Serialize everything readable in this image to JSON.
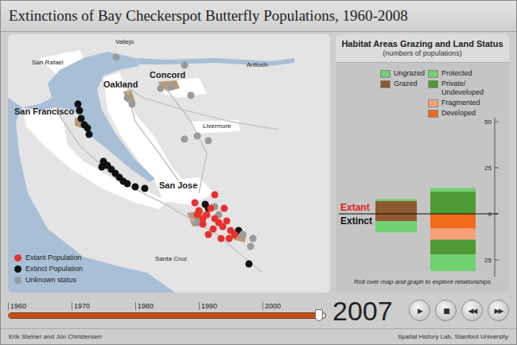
{
  "title": "Extinctions of Bay Checkerspot Butterfly Populations, 1960-2008",
  "map": {
    "cities": [
      {
        "name": "Vallejo",
        "major": false
      },
      {
        "name": "San Rafael",
        "major": false
      },
      {
        "name": "Antioch",
        "major": false
      },
      {
        "name": "Oakland",
        "major": true
      },
      {
        "name": "Concord",
        "major": true
      },
      {
        "name": "San Francisco",
        "major": true
      },
      {
        "name": "Livermore",
        "major": false
      },
      {
        "name": "San Jose",
        "major": true
      },
      {
        "name": "Santa Cruz",
        "major": false
      }
    ],
    "populations": [
      {
        "status": "extinct",
        "color": "#111111"
      },
      {
        "status": "extinct",
        "color": "#111111"
      },
      {
        "status": "extinct",
        "color": "#111111"
      },
      {
        "status": "extinct",
        "color": "#111111"
      },
      {
        "status": "extinct",
        "color": "#111111"
      },
      {
        "status": "extinct",
        "color": "#111111"
      },
      {
        "status": "extinct",
        "color": "#111111"
      },
      {
        "status": "extinct",
        "color": "#111111"
      },
      {
        "status": "extinct",
        "color": "#111111"
      },
      {
        "status": "extinct",
        "color": "#111111"
      },
      {
        "status": "extinct",
        "color": "#111111"
      },
      {
        "status": "extinct",
        "color": "#111111"
      },
      {
        "status": "extinct",
        "color": "#111111"
      },
      {
        "status": "extinct",
        "color": "#111111"
      },
      {
        "status": "extinct",
        "color": "#111111"
      },
      {
        "status": "extinct",
        "color": "#111111"
      },
      {
        "status": "extinct",
        "color": "#111111"
      },
      {
        "status": "extinct",
        "color": "#111111"
      },
      {
        "status": "extinct",
        "color": "#111111"
      },
      {
        "status": "extinct",
        "color": "#111111"
      },
      {
        "status": "unknown",
        "color": "#9a9a9a"
      },
      {
        "status": "unknown",
        "color": "#9a9a9a"
      },
      {
        "status": "unknown",
        "color": "#9a9a9a"
      },
      {
        "status": "unknown",
        "color": "#9a9a9a"
      },
      {
        "status": "unknown",
        "color": "#9a9a9a"
      },
      {
        "status": "unknown",
        "color": "#9a9a9a"
      },
      {
        "status": "unknown",
        "color": "#9a9a9a"
      },
      {
        "status": "unknown",
        "color": "#9a9a9a"
      },
      {
        "status": "unknown",
        "color": "#9a9a9a"
      },
      {
        "status": "unknown",
        "color": "#9a9a9a"
      },
      {
        "status": "unknown",
        "color": "#9a9a9a"
      },
      {
        "status": "unknown",
        "color": "#9a9a9a"
      },
      {
        "status": "unknown",
        "color": "#9a9a9a"
      },
      {
        "status": "unknown",
        "color": "#9a9a9a"
      },
      {
        "status": "unknown",
        "color": "#9a9a9a"
      },
      {
        "status": "unknown",
        "color": "#9a9a9a"
      },
      {
        "status": "extant",
        "color": "#e8312f"
      },
      {
        "status": "extant",
        "color": "#e8312f"
      },
      {
        "status": "extant",
        "color": "#e8312f"
      },
      {
        "status": "extant",
        "color": "#e8312f"
      },
      {
        "status": "extant",
        "color": "#e8312f"
      },
      {
        "status": "extant",
        "color": "#e8312f"
      },
      {
        "status": "extant",
        "color": "#e8312f"
      },
      {
        "status": "extant",
        "color": "#e8312f"
      },
      {
        "status": "extant",
        "color": "#e8312f"
      },
      {
        "status": "extant",
        "color": "#e8312f"
      },
      {
        "status": "extant",
        "color": "#e8312f"
      },
      {
        "status": "extant",
        "color": "#e8312f"
      },
      {
        "status": "extant",
        "color": "#e8312f"
      },
      {
        "status": "extant",
        "color": "#e8312f"
      },
      {
        "status": "extant",
        "color": "#e8312f"
      },
      {
        "status": "extant",
        "color": "#e8312f"
      },
      {
        "status": "extant",
        "color": "#e8312f"
      },
      {
        "status": "extant",
        "color": "#e8312f"
      },
      {
        "status": "extant",
        "color": "#e8312f"
      }
    ],
    "legend": [
      {
        "label": "Extant Population",
        "color": "#e8312f"
      },
      {
        "label": "Extinct Population",
        "color": "#111111"
      },
      {
        "label": "Unknown status",
        "color": "#9a9a9a"
      }
    ]
  },
  "chart": {
    "title": "Habitat Areas Grazing and Land Status",
    "subtitle": "(numbers of populations)",
    "extant_label": "Extant",
    "extinct_label": "Extinct",
    "ticks": [
      {
        "label": "50",
        "value": 50
      },
      {
        "label": "25",
        "value": 25
      },
      {
        "label": "0",
        "value": 0
      },
      {
        "label": "25",
        "value": -25
      }
    ],
    "groups": [
      {
        "series": [
          {
            "name": "Ungrazed",
            "color": "#6fd16f",
            "extant": 1,
            "extinct": 6
          },
          {
            "name": "Grazed",
            "color": "#8c5a2e",
            "extant": 7,
            "extinct": 4
          }
        ]
      },
      {
        "series": [
          {
            "name": "Protected",
            "color": "#6fd16f",
            "extant": 2,
            "extinct": 9
          },
          {
            "name": "Private/\nUndeveloped",
            "color": "#4e9a35",
            "extant": 12,
            "extinct": 8
          },
          {
            "name": "Fragmented",
            "color": "#f7a07a",
            "extant": 0,
            "extinct": 6
          },
          {
            "name": "Developed",
            "color": "#f26a1c",
            "extant": 0,
            "extinct": 8
          }
        ]
      }
    ],
    "note": "Roll over map and graph to explore relationships"
  },
  "timeline": {
    "ticks": [
      "1960",
      "1970",
      "1980",
      "1990",
      "2000"
    ],
    "level": 0.98,
    "year": "2007",
    "buttons": [
      "▶",
      "■",
      "◀◀",
      "▶▶"
    ]
  },
  "footer": {
    "left": "Erik Steiner and Jon Christensen",
    "right": "Spatial History Lab, Stanford University"
  }
}
